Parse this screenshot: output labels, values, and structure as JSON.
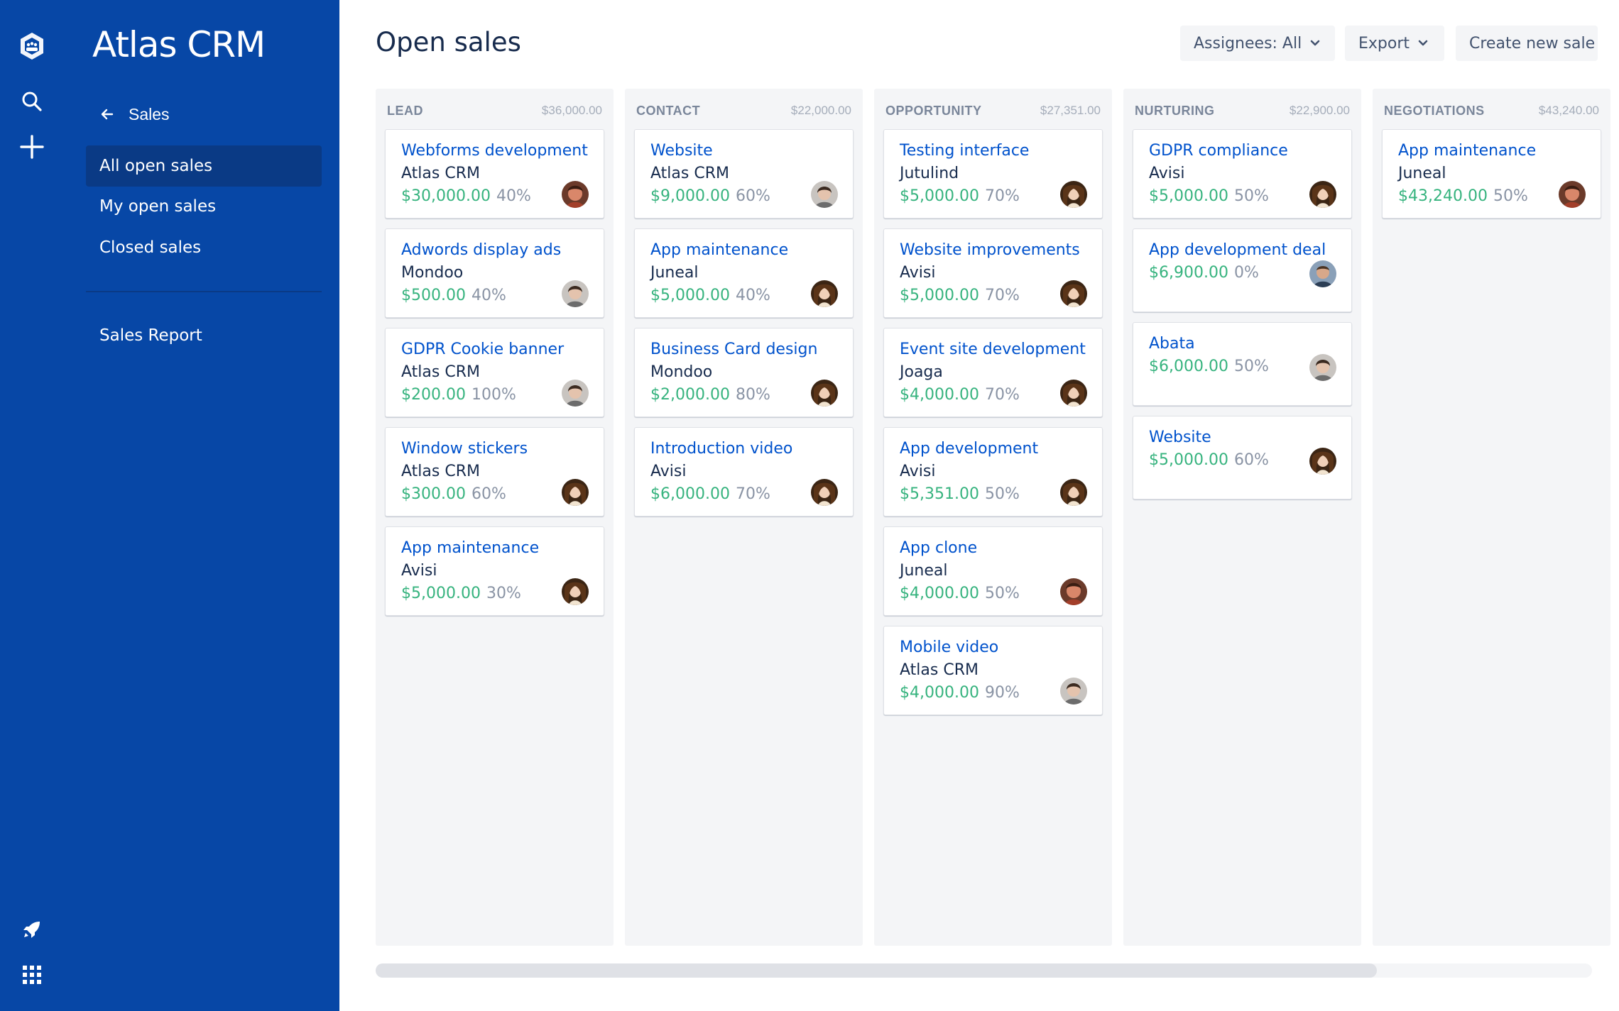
{
  "product": {
    "title": "Atlas CRM"
  },
  "sidebar": {
    "back_label": "Sales",
    "items": [
      {
        "label": "All open sales",
        "active": true
      },
      {
        "label": "My open sales",
        "active": false
      },
      {
        "label": "Closed sales",
        "active": false
      }
    ],
    "report_label": "Sales Report"
  },
  "header": {
    "title": "Open sales",
    "assignees_label": "Assignees: All",
    "export_label": "Export",
    "create_label": "Create new sale"
  },
  "columns": [
    {
      "title": "LEAD",
      "total": "$36,000.00",
      "cards": [
        {
          "title": "Webforms development",
          "company": "Atlas CRM",
          "value": "$30,000.00",
          "probability": "40%",
          "avatar": "avatar-red"
        },
        {
          "title": "Adwords display ads",
          "company": "Mondoo",
          "value": "$500.00",
          "probability": "40%",
          "avatar": "avatar-grey"
        },
        {
          "title": "GDPR Cookie banner",
          "company": "Atlas CRM",
          "value": "$200.00",
          "probability": "100%",
          "avatar": "avatar-grey"
        },
        {
          "title": "Window stickers",
          "company": "Atlas CRM",
          "value": "$300.00",
          "probability": "60%",
          "avatar": "avatar-dark"
        },
        {
          "title": "App maintenance",
          "company": "Avisi",
          "value": "$5,000.00",
          "probability": "30%",
          "avatar": "avatar-dark"
        }
      ]
    },
    {
      "title": "CONTACT",
      "total": "$22,000.00",
      "cards": [
        {
          "title": "Website",
          "company": "Atlas CRM",
          "value": "$9,000.00",
          "probability": "60%",
          "avatar": "avatar-grey"
        },
        {
          "title": "App maintenance",
          "company": "Juneal",
          "value": "$5,000.00",
          "probability": "40%",
          "avatar": "avatar-dark"
        },
        {
          "title": "Business Card design",
          "company": "Mondoo",
          "value": "$2,000.00",
          "probability": "80%",
          "avatar": "avatar-dark"
        },
        {
          "title": "Introduction video",
          "company": "Avisi",
          "value": "$6,000.00",
          "probability": "70%",
          "avatar": "avatar-dark"
        }
      ]
    },
    {
      "title": "OPPORTUNITY",
      "total": "$27,351.00",
      "cards": [
        {
          "title": "Testing interface",
          "company": "Jutulind",
          "value": "$5,000.00",
          "probability": "70%",
          "avatar": "avatar-dark"
        },
        {
          "title": "Website improvements",
          "company": "Avisi",
          "value": "$5,000.00",
          "probability": "70%",
          "avatar": "avatar-dark"
        },
        {
          "title": "Event site development",
          "company": "Joaga",
          "value": "$4,000.00",
          "probability": "70%",
          "avatar": "avatar-dark"
        },
        {
          "title": "App development",
          "company": "Avisi",
          "value": "$5,351.00",
          "probability": "50%",
          "avatar": "avatar-dark"
        },
        {
          "title": "App clone",
          "company": "Juneal",
          "value": "$4,000.00",
          "probability": "50%",
          "avatar": "avatar-red"
        },
        {
          "title": "Mobile video",
          "company": "Atlas CRM",
          "value": "$4,000.00",
          "probability": "90%",
          "avatar": "avatar-grey"
        }
      ]
    },
    {
      "title": "NURTURING",
      "total": "$22,900.00",
      "cards": [
        {
          "title": "GDPR compliance",
          "company": "Avisi",
          "value": "$5,000.00",
          "probability": "50%",
          "avatar": "avatar-dark"
        },
        {
          "title": "App development deal",
          "company": "",
          "value": "$6,900.00",
          "probability": "0%",
          "avatar": "avatar-blue"
        },
        {
          "title": "Abata",
          "company": "",
          "value": "$6,000.00",
          "probability": "50%",
          "avatar": "avatar-grey"
        },
        {
          "title": "Website",
          "company": "",
          "value": "$5,000.00",
          "probability": "60%",
          "avatar": "avatar-dark"
        }
      ]
    },
    {
      "title": "NEGOTIATIONS",
      "total": "$43,240.00",
      "cards": [
        {
          "title": "App maintenance",
          "company": "Juneal",
          "value": "$43,240.00",
          "probability": "50%",
          "avatar": "avatar-red"
        }
      ]
    }
  ],
  "colors": {
    "sidebar_bg": "#0747a6",
    "active_item_bg": "#0a3a85",
    "link": "#0052cc",
    "value": "#36b37e",
    "muted": "#8993a4"
  },
  "icons": {
    "rail": [
      "app-logo-icon",
      "search-icon",
      "plus-icon",
      "rocket-icon",
      "app-switcher-icon"
    ],
    "back": "arrow-left-icon",
    "dropdown": "chevron-down-icon"
  }
}
